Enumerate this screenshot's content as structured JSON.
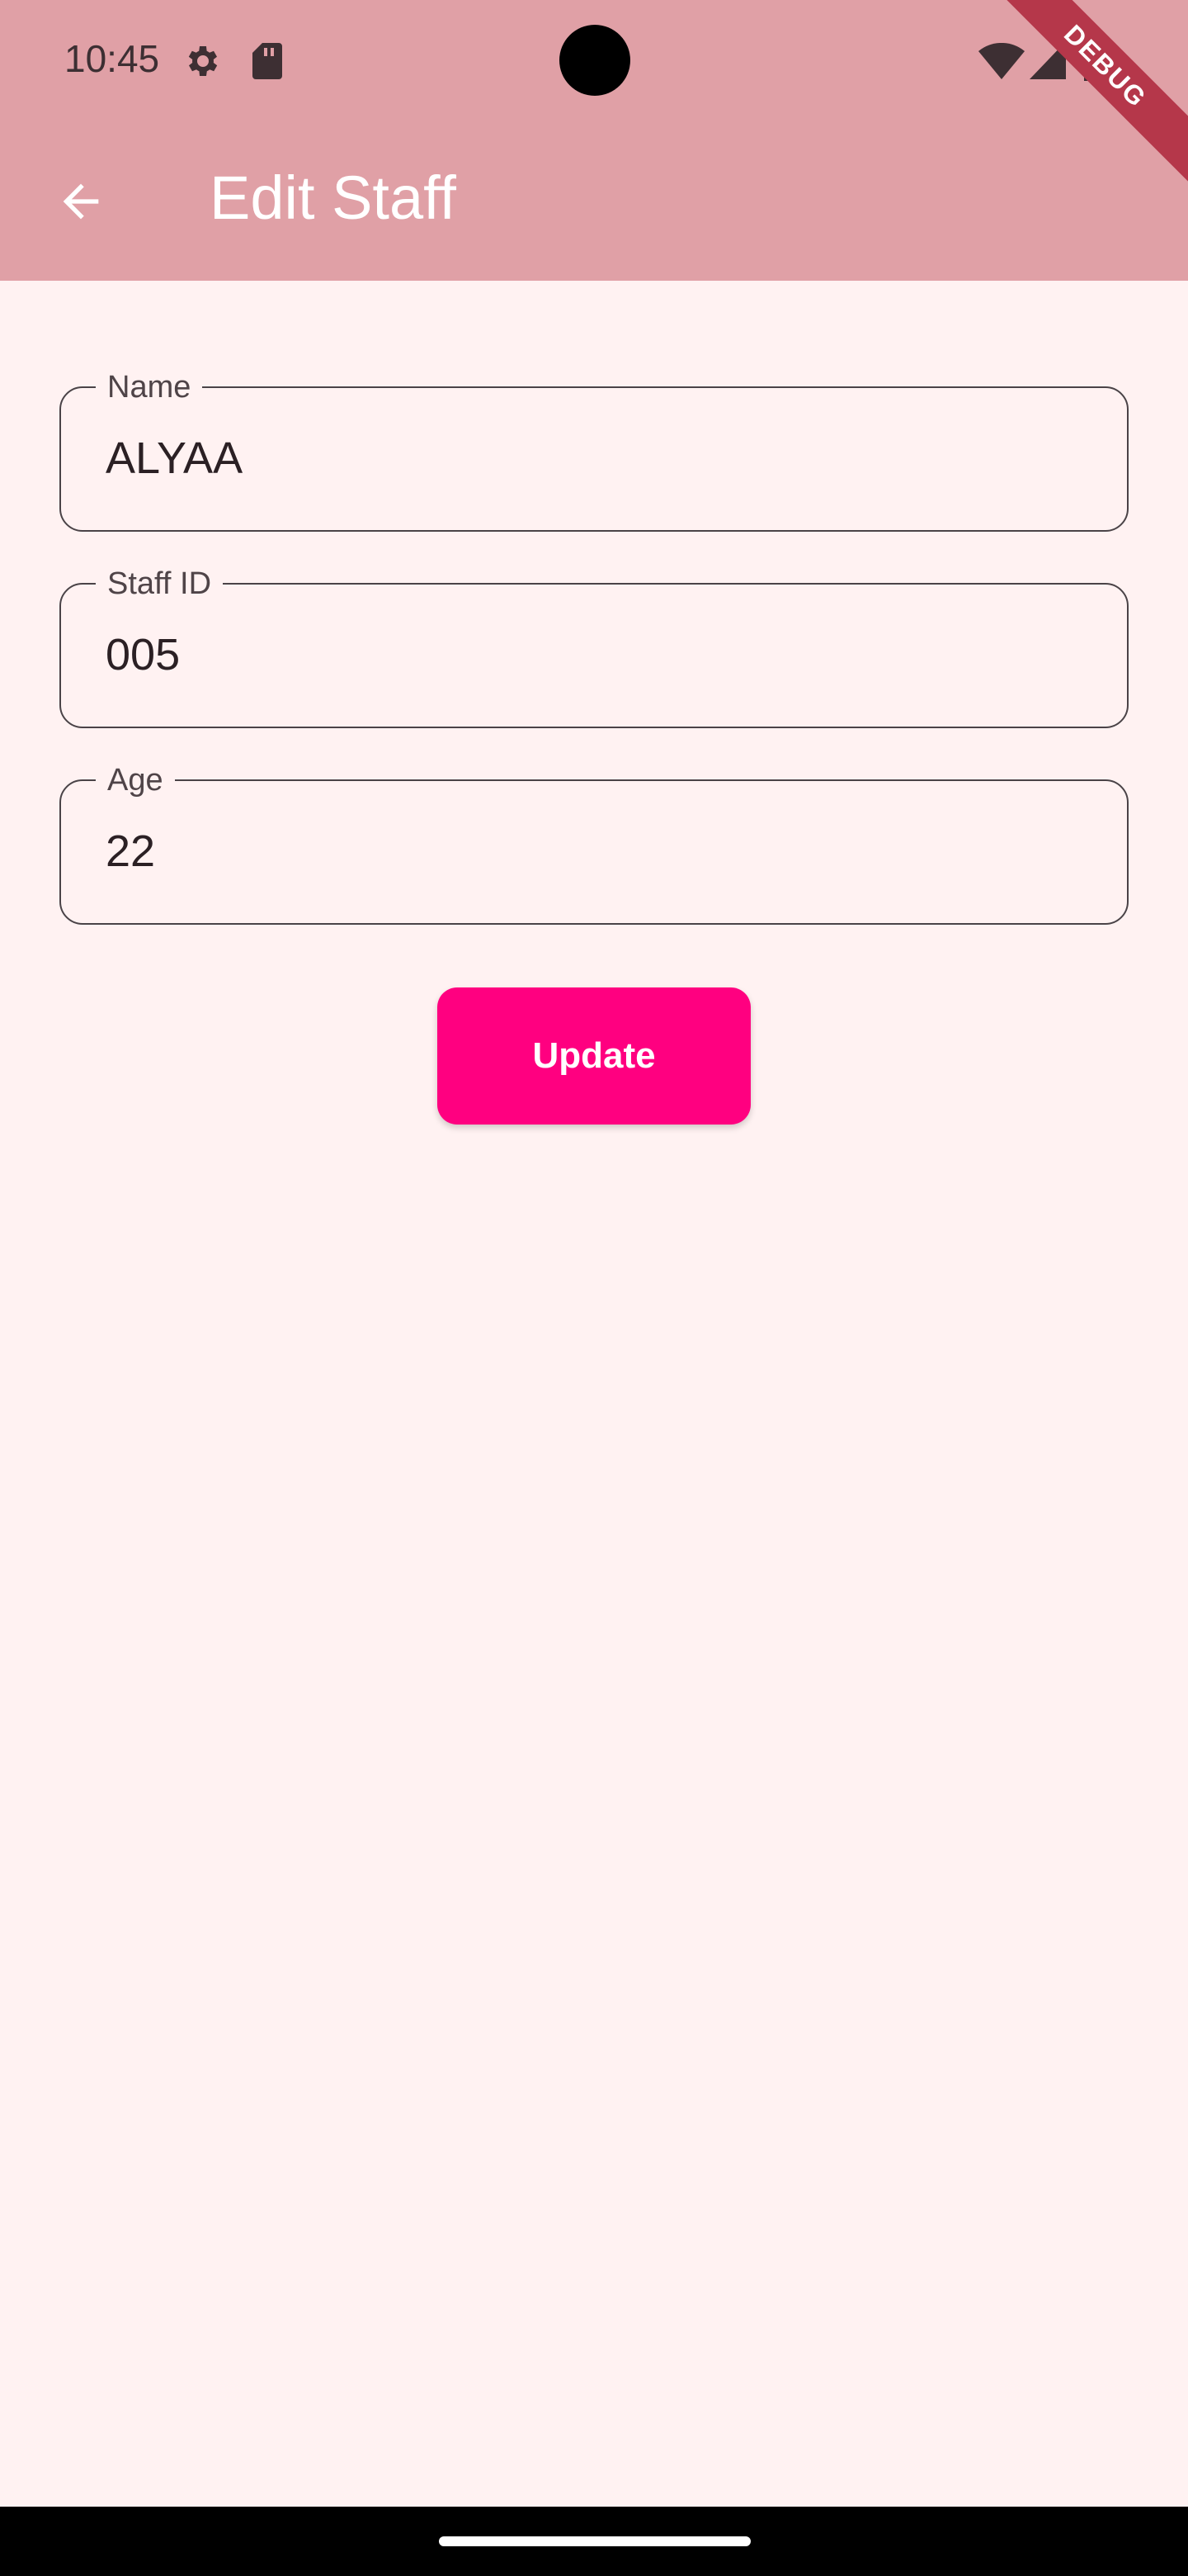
{
  "status_bar": {
    "time": "10:45",
    "icons": [
      "gear-icon",
      "sd-card-icon",
      "wifi-icon",
      "signal-icon",
      "battery-icon"
    ]
  },
  "debug_banner": "DEBUG",
  "app_bar": {
    "title": "Edit Staff",
    "back_icon": "arrow-back-icon",
    "color": "#e0a0a6"
  },
  "form": {
    "fields": [
      {
        "label": "Name",
        "value": "ALYAA"
      },
      {
        "label": "Staff ID",
        "value": "005"
      },
      {
        "label": "Age",
        "value": "22"
      }
    ],
    "submit_label": "Update",
    "submit_color": "#ff0080"
  },
  "colors": {
    "background": "#fff2f2",
    "field_border": "#4a4347"
  }
}
